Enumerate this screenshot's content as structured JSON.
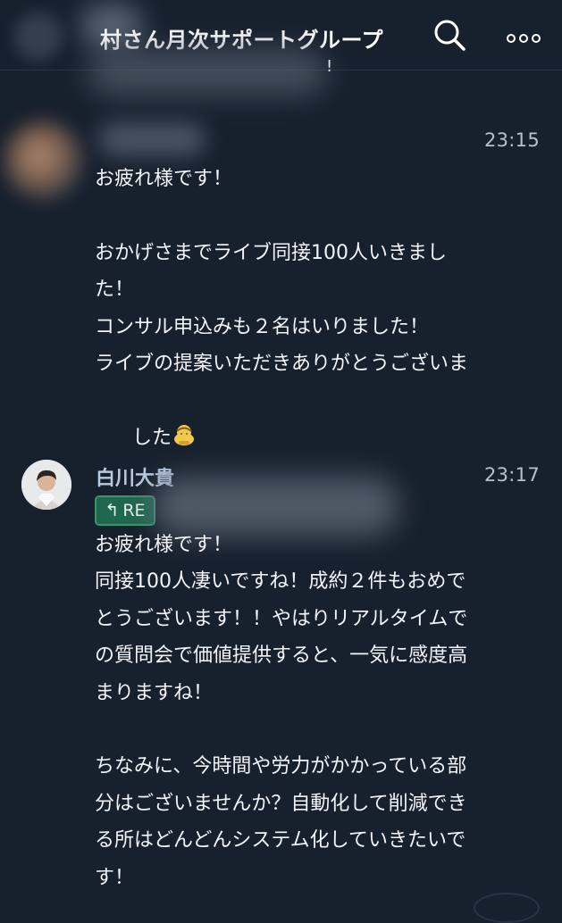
{
  "header": {
    "title": "村さん月次サポートグループ",
    "preview_tail": "!",
    "search_icon": "search-icon",
    "more_icon": "more-icon"
  },
  "messages": [
    {
      "sender": "",
      "time": "23:15",
      "lines": [
        "お疲れ様です！",
        "",
        "おかげさまでライブ同接100人いきまし",
        "た！",
        "コンサル申込みも２名はいりました！",
        "ライブの提案いただきありがとうございま",
        "した"
      ],
      "emoji": "bow-emoji"
    },
    {
      "sender": "白川大貴",
      "time": "23:17",
      "reply_label": "RE",
      "lines": [
        "お疲れ様です！",
        "同接100人凄いですね！成約２件もおめで",
        "とうございます！！やはりリアルタイムで",
        "の質問会で価値提供すると、一気に感度高",
        "まりますね！",
        "",
        "ちなみに、今時間や労力がかかっている部",
        "分はございませんか？自動化して削減でき",
        "る所はどんどんシステム化していきたいで",
        "す！"
      ]
    }
  ],
  "colors": {
    "background": "#17202d",
    "reply_badge": "#21664f",
    "sender_name": "#b8c9e2",
    "timestamp": "#b7c0cb"
  }
}
